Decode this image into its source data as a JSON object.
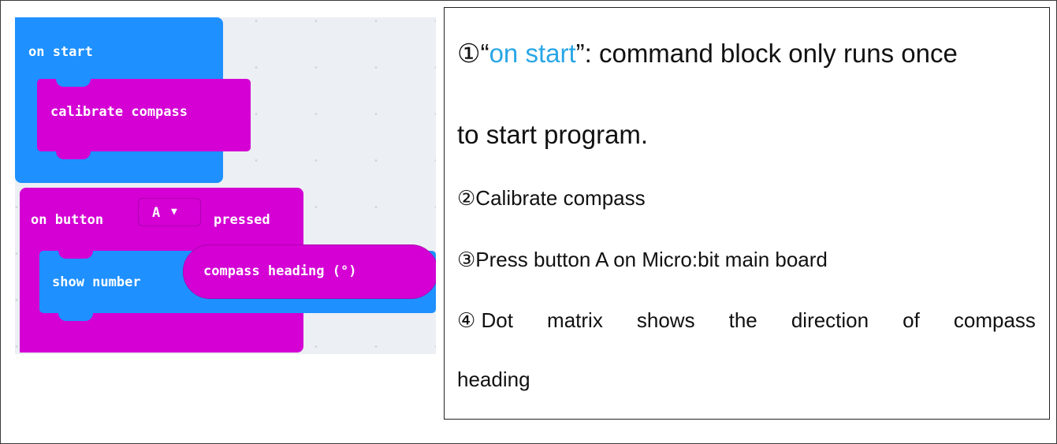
{
  "blocks": {
    "on_start": "on start",
    "calibrate": "calibrate compass",
    "on_button": "on button",
    "button_value": "A",
    "dropdown_arrow": "▼",
    "pressed": "pressed",
    "show_number": "show number",
    "compass_heading": "compass heading (°)"
  },
  "notes": {
    "line1_prefix": "①“",
    "line1_highlight": "on start",
    "line1_suffix": "”: command block only runs once",
    "line1_cont": "to start program.",
    "line2": "②Calibrate compass",
    "line3": "③Press button A on Micro:bit main board",
    "line4_words": [
      "④ Dot",
      "matrix",
      "shows",
      "the",
      "direction",
      "of",
      "compass"
    ],
    "line4_cont": "heading"
  },
  "colors": {
    "event_block": "#1e90ff",
    "input_block": "#d400d4",
    "highlight_text": "#29a6e6"
  }
}
